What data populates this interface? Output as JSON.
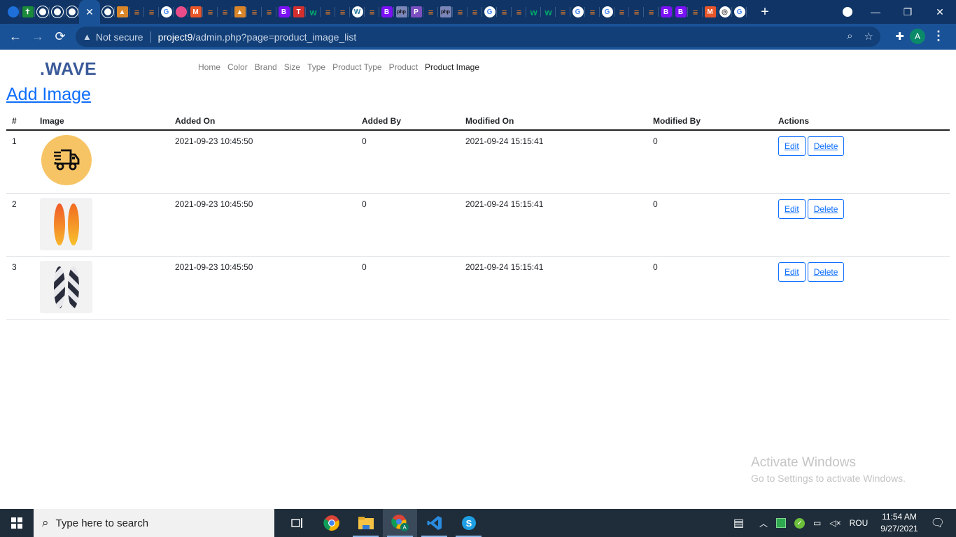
{
  "browser": {
    "tabs": [
      {
        "icon": "circle-blue"
      },
      {
        "icon": "cross-green"
      },
      {
        "icon": "globe"
      },
      {
        "icon": "globe"
      },
      {
        "icon": "globe"
      },
      {
        "icon": "close",
        "active": true
      },
      {
        "icon": "globe"
      },
      {
        "icon": "pma"
      },
      {
        "icon": "stackoverflow"
      },
      {
        "icon": "stackoverflow"
      },
      {
        "icon": "google"
      },
      {
        "icon": "dribbble"
      },
      {
        "icon": "m-logo"
      },
      {
        "icon": "stackoverflow"
      },
      {
        "icon": "stackoverflow"
      },
      {
        "icon": "pma"
      },
      {
        "icon": "stackoverflow"
      },
      {
        "icon": "stackoverflow"
      },
      {
        "icon": "bootstrap"
      },
      {
        "icon": "t-red"
      },
      {
        "icon": "w3"
      },
      {
        "icon": "stackoverflow"
      },
      {
        "icon": "stackoverflow"
      },
      {
        "icon": "wordpress"
      },
      {
        "icon": "stackoverflow"
      },
      {
        "icon": "bootstrap"
      },
      {
        "icon": "php"
      },
      {
        "icon": "p-purple"
      },
      {
        "icon": "stackoverflow"
      },
      {
        "icon": "php"
      },
      {
        "icon": "stackoverflow"
      },
      {
        "icon": "stackoverflow"
      },
      {
        "icon": "google"
      },
      {
        "icon": "stackoverflow"
      },
      {
        "icon": "stackoverflow"
      },
      {
        "icon": "w3"
      },
      {
        "icon": "w3"
      },
      {
        "icon": "stackoverflow"
      },
      {
        "icon": "google"
      },
      {
        "icon": "stackoverflow"
      },
      {
        "icon": "google"
      },
      {
        "icon": "stackoverflow"
      },
      {
        "icon": "stackoverflow"
      },
      {
        "icon": "stackoverflow"
      },
      {
        "icon": "bootstrap"
      },
      {
        "icon": "bootstrap"
      },
      {
        "icon": "stackoverflow"
      },
      {
        "icon": "m-logo"
      },
      {
        "icon": "chromium"
      },
      {
        "icon": "google"
      }
    ],
    "new_tab": "+",
    "security_label": "Not secure",
    "url_host": "project9",
    "url_path": "/admin.php?page=product_image_list",
    "profile_initial": "A",
    "window_controls": {
      "minimize": "—",
      "restore": "❐",
      "close": "✕"
    }
  },
  "page": {
    "brand": ".WAVE",
    "nav": [
      {
        "label": "Home",
        "active": false
      },
      {
        "label": "Color",
        "active": false
      },
      {
        "label": "Brand",
        "active": false
      },
      {
        "label": "Size",
        "active": false
      },
      {
        "label": "Type",
        "active": false
      },
      {
        "label": "Product Type",
        "active": false
      },
      {
        "label": "Product",
        "active": false
      },
      {
        "label": "Product Image",
        "active": true
      }
    ],
    "add_link": "Add Image",
    "table": {
      "headers": [
        "#",
        "Image",
        "Added On",
        "Added By",
        "Modified On",
        "Modified By",
        "Actions"
      ],
      "rows": [
        {
          "id": "1",
          "image": "delivery-truck",
          "added_on": "2021-09-23 10:45:50",
          "added_by": "0",
          "modified_on": "2021-09-24 15:15:41",
          "modified_by": "0"
        },
        {
          "id": "2",
          "image": "orange-surfboards",
          "added_on": "2021-09-23 10:45:50",
          "added_by": "0",
          "modified_on": "2021-09-24 15:15:41",
          "modified_by": "0"
        },
        {
          "id": "3",
          "image": "black-white-surfboards",
          "added_on": "2021-09-23 10:45:50",
          "added_by": "0",
          "modified_on": "2021-09-24 15:15:41",
          "modified_by": "0"
        }
      ],
      "edit_label": "Edit",
      "delete_label": "Delete"
    },
    "watermark": {
      "title": "Activate Windows",
      "subtitle": "Go to Settings to activate Windows."
    }
  },
  "taskbar": {
    "search_placeholder": "Type here to search",
    "apps": [
      "task-view",
      "chrome",
      "file-explorer",
      "chrome-profile",
      "vscode",
      "skype"
    ],
    "language": "ROU",
    "time": "11:54 AM",
    "date": "9/27/2021"
  }
}
